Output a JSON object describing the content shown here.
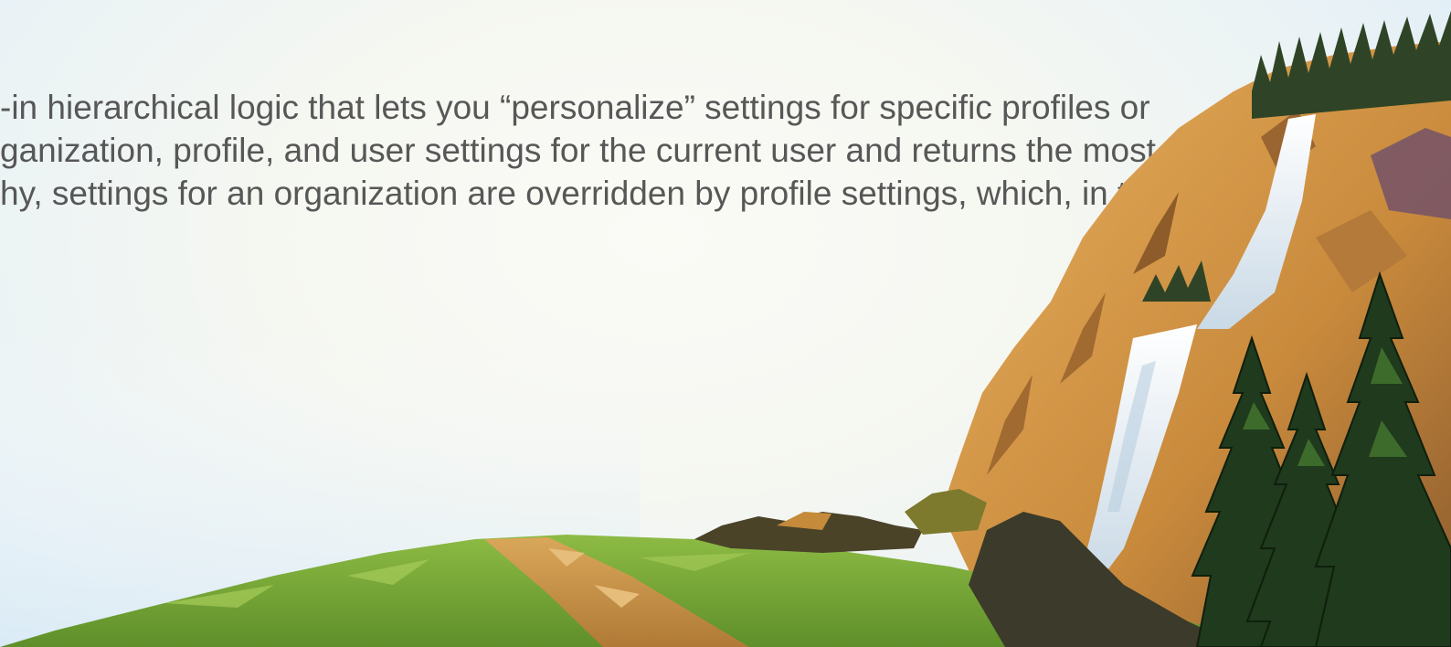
{
  "slide": {
    "body_lines": [
      "-in hierarchical logic that lets you “personalize” settings for specific profiles or",
      "ganization, profile, and user settings for the current user and returns the most",
      "hy, settings for an organization are overridden by profile settings, which, in turn, are"
    ]
  },
  "colors": {
    "text": "#575757",
    "sky_light": "#fbfbf6",
    "sky_blue": "#dcecf6",
    "grass": "#7aa83c",
    "path": "#c9944a",
    "cliff": "#d99a45",
    "waterfall": "#e8eef2",
    "pine": "#1f3a1c"
  },
  "icons": [
    "mountain-landscape-illustration"
  ]
}
